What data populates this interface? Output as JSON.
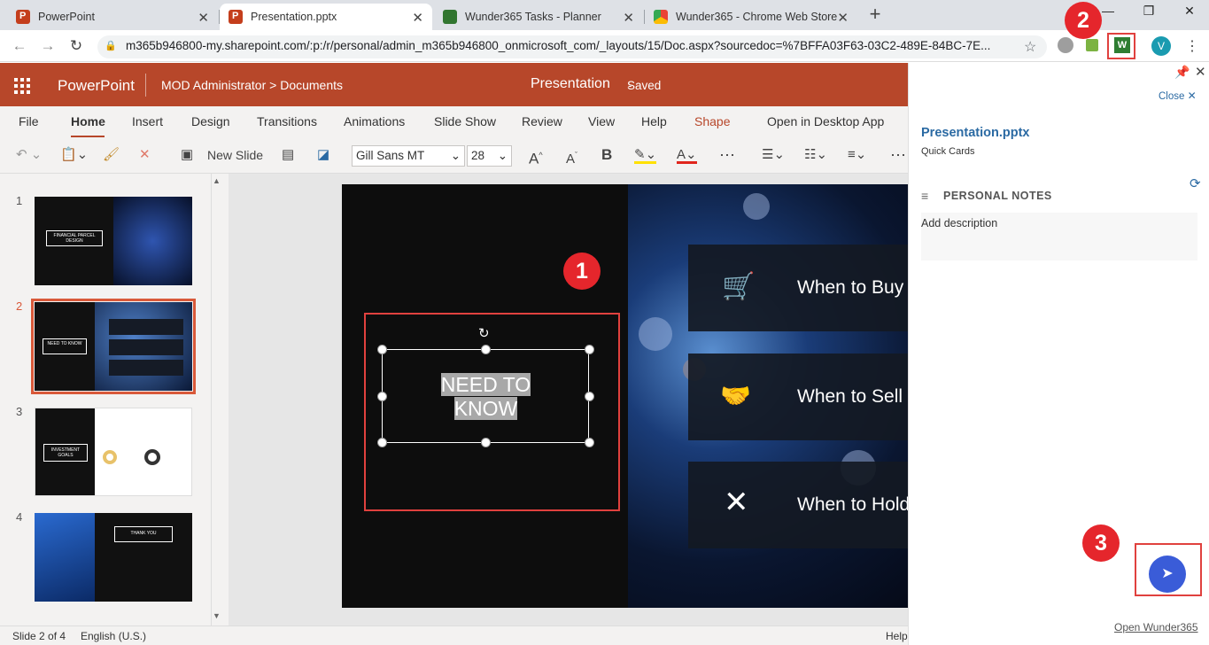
{
  "browser": {
    "tabs": [
      {
        "title": "PowerPoint",
        "icon": "powerpoint-icon"
      },
      {
        "title": "Presentation.pptx",
        "icon": "powerpoint-icon"
      },
      {
        "title": "Wunder365 Tasks - Planner",
        "icon": "planner-icon"
      },
      {
        "title": "Wunder365 - Chrome Web Store",
        "icon": "chrome-web-store-icon"
      }
    ],
    "url": "m365b946800-my.sharepoint.com/:p:/r/personal/admin_m365b946800_onmicrosoft_com/_layouts/15/Doc.aspx?sourcedoc=%7BFFA03F63-03C2-489E-84BC-7E...",
    "avatar": "V",
    "new_tab": "+"
  },
  "office": {
    "app_name": "PowerPoint",
    "breadcrumb": "MOD Administrator  >  Documents",
    "title": "Presentation",
    "separator": "-",
    "status": "Saved"
  },
  "ribbon": {
    "tabs": [
      "File",
      "Home",
      "Insert",
      "Design",
      "Transitions",
      "Animations",
      "Slide Show",
      "Review",
      "View",
      "Help",
      "Shape",
      "Open in Desktop App"
    ],
    "new_slide": "New Slide",
    "font": "Gill Sans MT",
    "size": "28",
    "bold": "B",
    "more": "⋯",
    "grow": "A",
    "shrink": "A",
    "font_color": "A"
  },
  "thumbnails": [
    {
      "num": "1",
      "title": "FINANCIAL PARCEL DESIGN"
    },
    {
      "num": "2",
      "title": "NEED TO KNOW"
    },
    {
      "num": "3",
      "title": "INVESTMENT GOALS"
    },
    {
      "num": "4",
      "title": "THANK YOU"
    }
  ],
  "slide": {
    "title_line1": "NEED TO",
    "title_line2": "KNOW",
    "cards": [
      "When to Buy",
      "When to Sell",
      "When to Hold"
    ]
  },
  "badges": [
    "1",
    "2",
    "3"
  ],
  "panel": {
    "close": "Close",
    "file": "Presentation.pptx",
    "subtitle": "Quick Cards",
    "notes_header": "PERSONAL NOTES",
    "description": "Add description",
    "open_link": "Open Wunder365"
  },
  "statusbar": {
    "slide": "Slide 2 of 4",
    "language": "English (U.S.)",
    "help": "Help"
  },
  "colors": {
    "office_brand": "#b7472a",
    "link": "#2b6aa3",
    "annotation": "#e0413e",
    "fab": "#3a5cd8"
  }
}
